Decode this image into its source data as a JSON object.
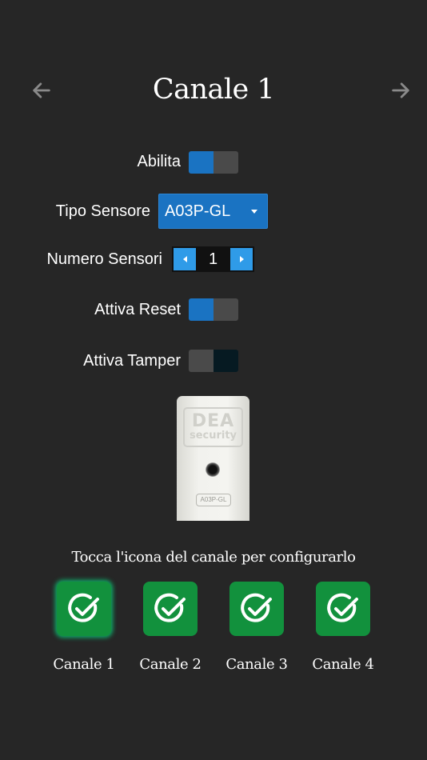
{
  "header": {
    "title": "Canale 1",
    "prev_icon": "arrow-left-icon",
    "next_icon": "arrow-right-icon"
  },
  "settings": {
    "enable_label": "Abilita",
    "enable_on": true,
    "sensor_type_label": "Tipo Sensore",
    "sensor_type_value": "A03P-GL",
    "sensor_count_label": "Numero Sensori",
    "sensor_count_value": "1",
    "reset_label": "Attiva Reset",
    "reset_on": true,
    "tamper_label": "Attiva Tamper",
    "tamper_on": false
  },
  "sensor_image": {
    "brand_big": "DEA",
    "brand_small": "security",
    "model_tag": "A03P-GL"
  },
  "channels": {
    "hint": "Tocca l'icona del canale per configurarlo",
    "items": [
      {
        "label": "Canale 1",
        "active": true
      },
      {
        "label": "Canale 2",
        "active": false
      },
      {
        "label": "Canale 3",
        "active": false
      },
      {
        "label": "Canale 4",
        "active": false
      }
    ]
  },
  "colors": {
    "background": "#262626",
    "accent_blue": "#1a73c2",
    "stepper_blue": "#2f9be8",
    "channel_green": "#12913d"
  }
}
